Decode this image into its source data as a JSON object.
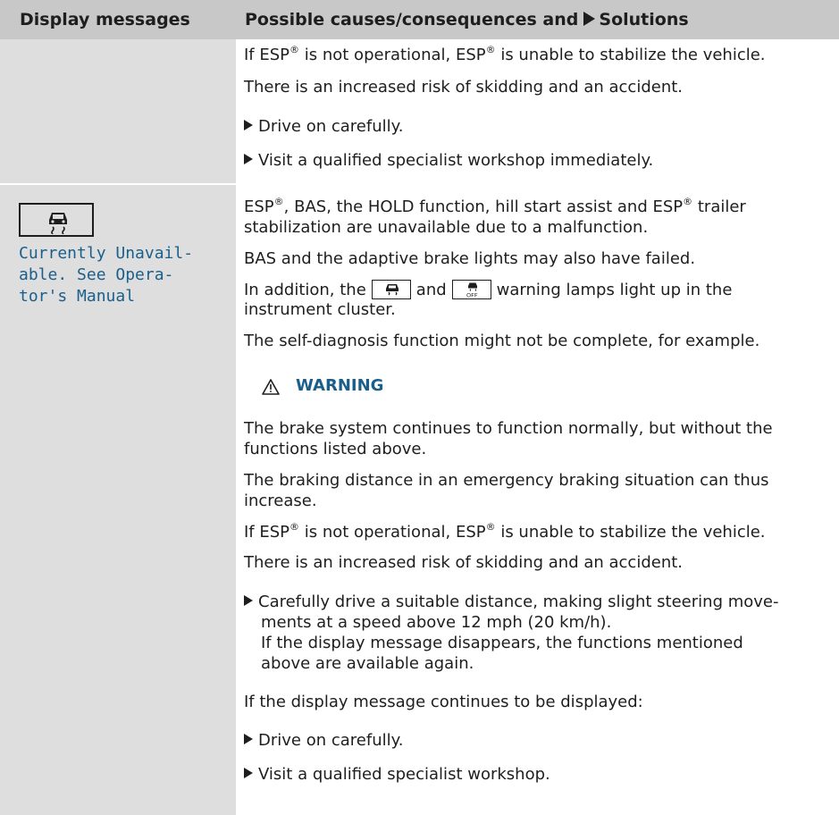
{
  "header": {
    "left": "Display messages",
    "right_a": "Possible causes/consequences and",
    "right_b": "Solutions"
  },
  "row1": {
    "line1a": "If ESP",
    "line1b": " is not operational, ESP",
    "line1c": " is unable to stabilize the vehicle.",
    "reg": "®",
    "line2": "There is an increased risk of skidding and an accident.",
    "bullet1": "Drive on carefully.",
    "bullet2": "Visit a qualified specialist workshop immediately."
  },
  "row2": {
    "message_lines": [
      "Currently Unavail-",
      "able. See Opera-",
      "tor's Manual"
    ],
    "p1_l1a": "ESP",
    "p1_l1b": ", BAS, the HOLD function, hill start assist and ESP",
    "p1_l1c": " trailer",
    "p1_l2": "stabilization are unavailable due to a malfunction.",
    "p2": "BAS and the adaptive brake lights may also have failed.",
    "p3_a": "In addition, the",
    "p3_b": "and",
    "p3_c": "warning lamps light up in the",
    "p3_l2": "instrument cluster.",
    "p4": "The self-diagnosis function might not be complete, for example.",
    "warning_label": "WARNING",
    "w1_l1": "The brake system continues to function normally, but without the",
    "w1_l2": "functions listed above.",
    "w2_l1": "The braking distance in an emergency braking situation can thus",
    "w2_l2": "increase.",
    "w3a": "If ESP",
    "w3b": " is not operational, ESP",
    "w3c": " is unable to stabilize the vehicle.",
    "w4": "There is an increased risk of skidding and an accident.",
    "b1_l1": "Carefully drive a suitable distance, making slight steering move-",
    "b1_l2": "ments at a speed above 12 mph (20 km/h).",
    "b1_l3": "If the display message disappears, the functions mentioned",
    "b1_l4": "above are available again.",
    "p5": "If the display message continues to be displayed:",
    "b2": "Drive on carefully.",
    "b3": "Visit a qualified specialist workshop."
  },
  "colors": {
    "accent": "#1a5f8c",
    "header_bg": "#c8c8c8",
    "left_col_bg": "#dedede"
  },
  "icons": [
    "esp-skid-icon",
    "esp-off-icon",
    "warning-triangle-icon",
    "arrow-bullet-icon"
  ]
}
